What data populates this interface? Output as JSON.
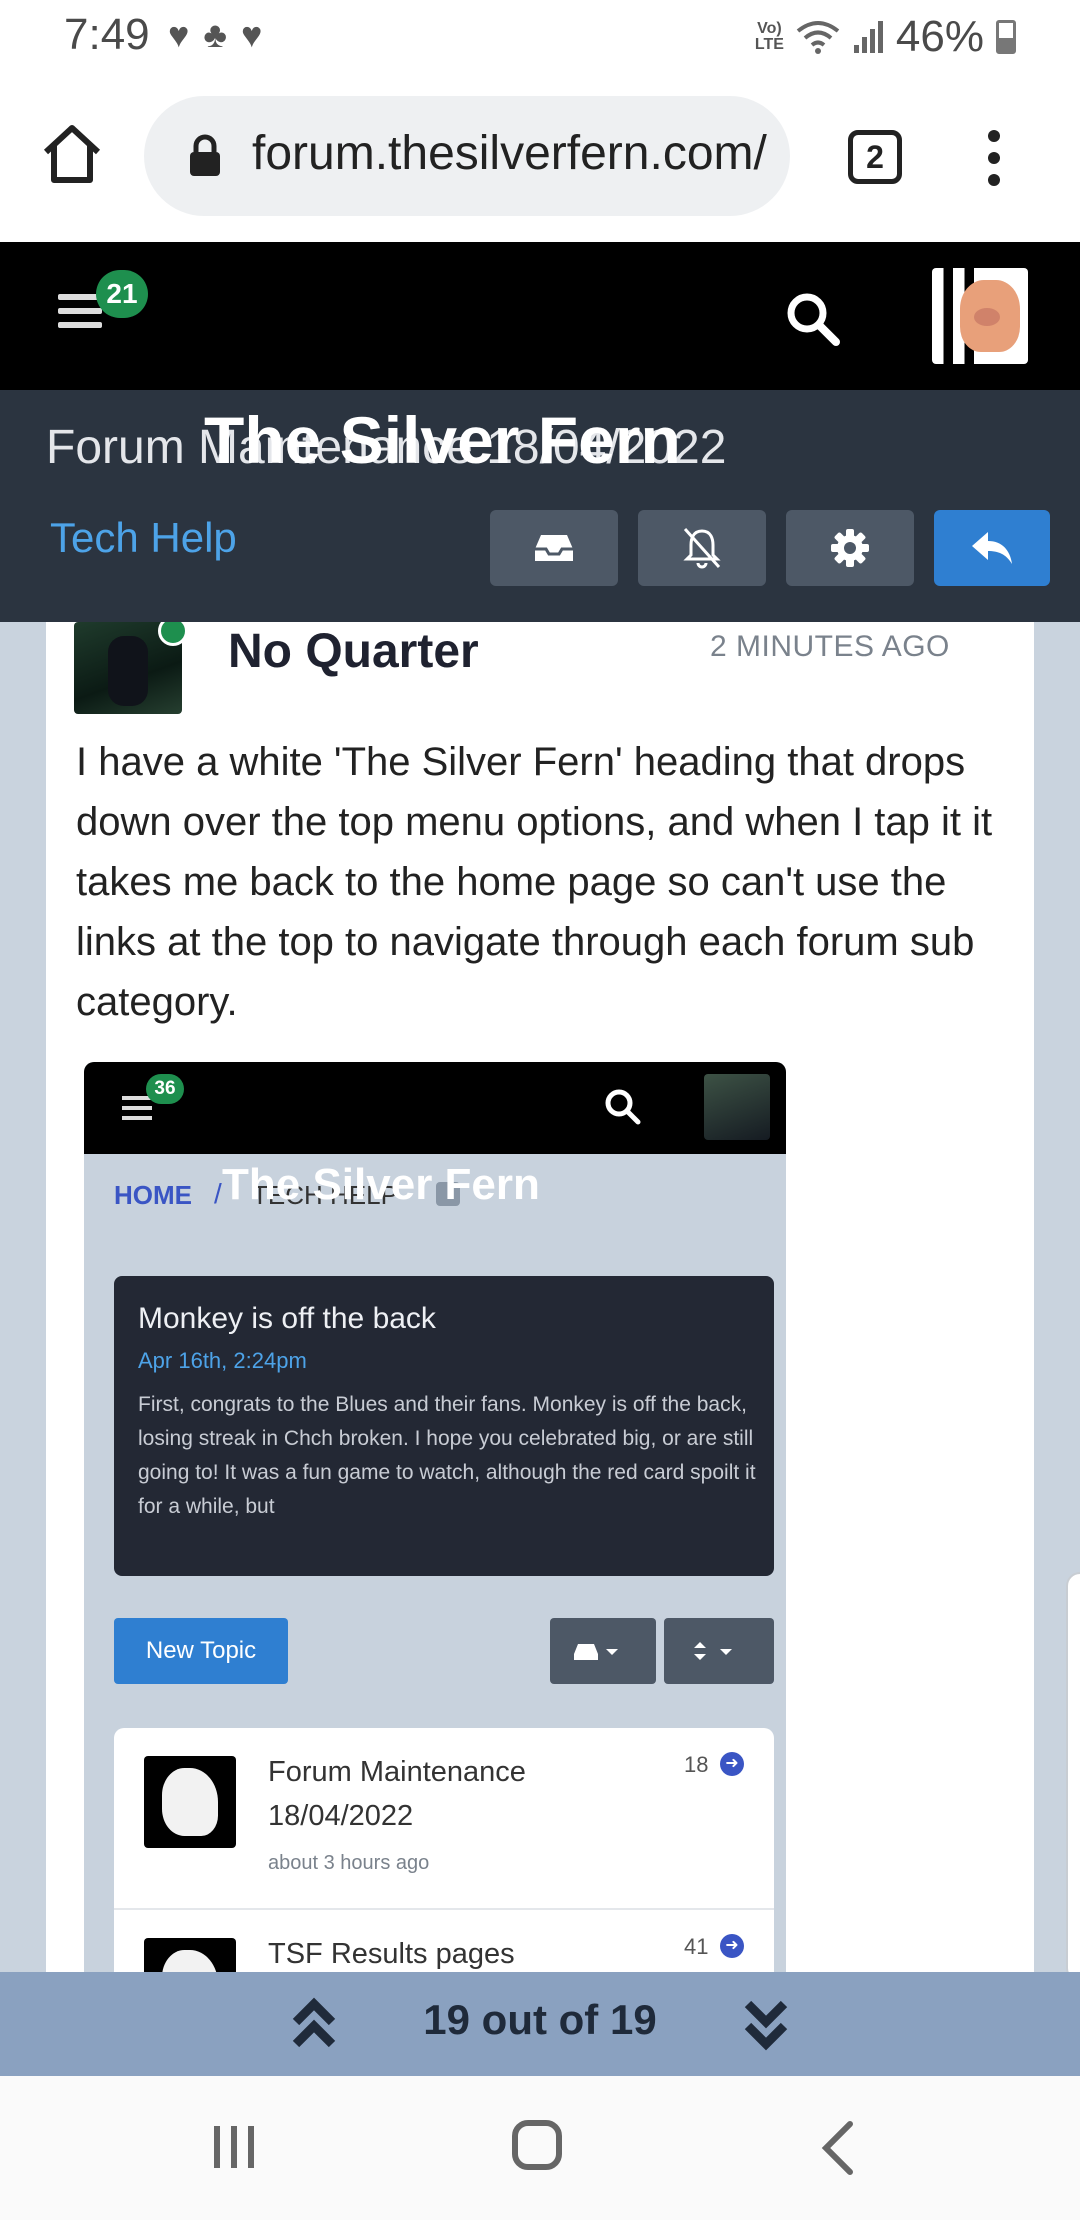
{
  "status_bar": {
    "time": "7:49",
    "volte_top": "Vo)",
    "volte_bottom": "LTE",
    "battery": "46%"
  },
  "browser": {
    "url": "forum.thesilverfern.com/",
    "tab_count": "2"
  },
  "forum_header": {
    "notification_count": "21"
  },
  "topic": {
    "title": "Forum Maintenance 18/04/2022",
    "site_title_overlay": "The Silver Fern",
    "category": "Tech Help"
  },
  "post": {
    "author": "No Quarter",
    "time": "2 MINUTES AGO",
    "body": "I have a white 'The Silver Fern' heading that drops down over the top menu options, and when I tap it it takes me back to the home page so can't use the links at the top to navigate through each forum sub category."
  },
  "embedded_screenshot": {
    "notification_count": "36",
    "breadcrumb_home": "HOME",
    "breadcrumb_sep": "/",
    "breadcrumb_current": "TECH HELP",
    "site_title_overlay": "The Silver Fern",
    "announcement": {
      "title": "Monkey is off the back",
      "date": "Apr 16th, 2:24pm",
      "text": "First, congrats to the Blues and their fans. Monkey is off the back, losing streak in Chch broken. I hope you celebrated big, or are still going to! It was a fun game to watch, although the red card spoilt it for a while, but"
    },
    "new_topic_label": "New Topic",
    "topics": [
      {
        "title": "Forum Maintenance 18/04/2022",
        "time": "about 3 hours ago",
        "count": "18"
      },
      {
        "title": "TSF Results pages",
        "time": "",
        "count": "41"
      }
    ]
  },
  "pager": {
    "text": "19 out of 19"
  },
  "colors": {
    "accent_blue": "#2f7fd1",
    "badge_green": "#1e8f4e",
    "topic_bar": "#2b3440",
    "pager_bg": "#8aa1c0"
  }
}
